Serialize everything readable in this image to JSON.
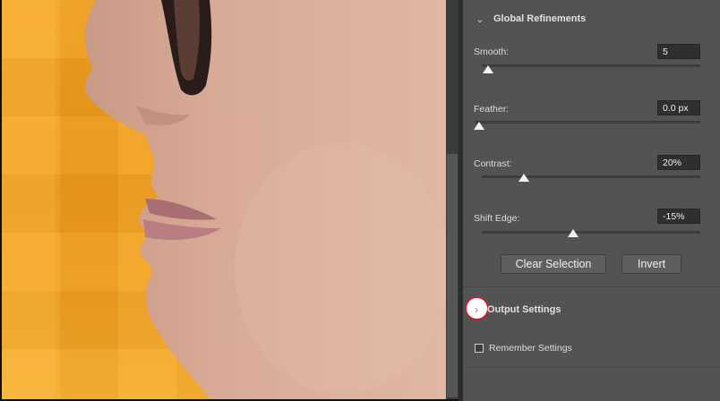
{
  "global_refinements": {
    "title": "Global Refinements",
    "icon": "chevron-down-icon"
  },
  "sliders": [
    {
      "label": "Smooth:",
      "value": "5",
      "level_percent": 3
    },
    {
      "label": "Feather:",
      "value": "0.0 px",
      "level_percent": 0
    },
    {
      "label": "Contrast:",
      "value": "20%",
      "level_percent": 20
    },
    {
      "label": "Shift Edge:",
      "value": "-15%",
      "level_percent": 42
    }
  ],
  "buttons": {
    "clear_selection": "Clear Selection",
    "invert": "Invert"
  },
  "output_settings": {
    "title": "Output Settings",
    "icon": "chevron-right-icon",
    "expanded": false
  },
  "remember_settings": {
    "label": "Remember Settings",
    "checked": false
  },
  "colors": {
    "panel_bg": "#535353",
    "canvas_orange": "#f4a11e",
    "highlight_red": "#c8202f"
  }
}
